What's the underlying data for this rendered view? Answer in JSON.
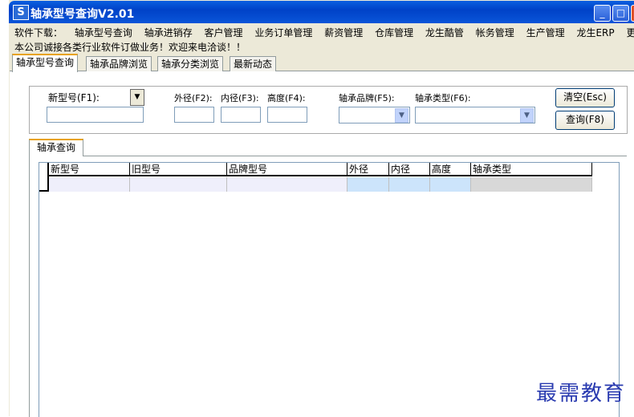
{
  "window": {
    "title": "轴承型号查询V2.01",
    "controls": [
      "minimize",
      "maximize",
      "close"
    ]
  },
  "menu": {
    "items": [
      "软件下载：",
      "轴承型号查询",
      "轴承进销存",
      "客户管理",
      "业务订单管理",
      "薪资管理",
      "仓库管理",
      "龙生酷管",
      "帐务管理",
      "生产管理",
      "龙生ERP",
      "更多..."
    ]
  },
  "notice": "本公司诚接各类行业软件订做业务！欢迎来电洽谈！！",
  "tabs": [
    {
      "label": "轴承型号查询",
      "active": true
    },
    {
      "label": "轴承品牌浏览"
    },
    {
      "label": "轴承分类浏览"
    },
    {
      "label": "最新动态"
    }
  ],
  "search": {
    "new_model_label": "新型号(F1):",
    "new_model_value": "",
    "outer_label": "外径(F2):",
    "inner_label": "内径(F3):",
    "height_label": "高度(F4):",
    "brand_label": "轴承品牌(F5):",
    "type_label": "轴承类型(F6):",
    "clear_button": "清空(Esc)",
    "query_button": "查询(F8)"
  },
  "results": {
    "tab_label": "轴承查询",
    "columns": [
      "新型号",
      "旧型号",
      "品牌型号",
      "外径",
      "内径",
      "高度",
      "轴承类型"
    ],
    "rows": []
  },
  "watermark": "最需教育"
}
